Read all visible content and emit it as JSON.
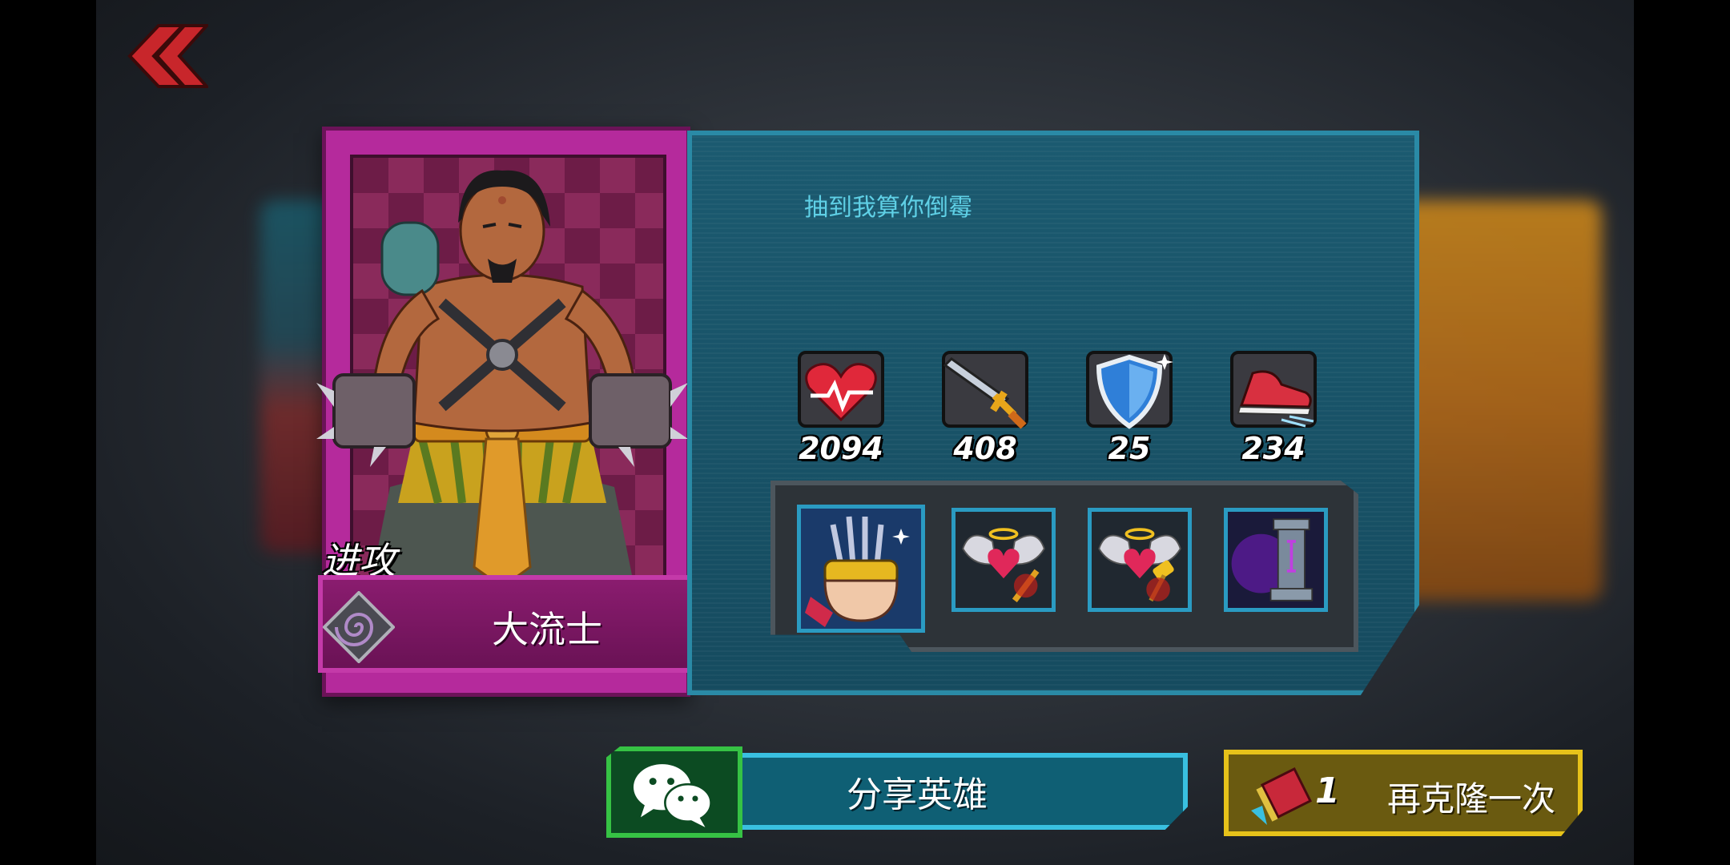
{
  "hero": {
    "role": "进攻",
    "name": "大流士",
    "quote": "抽到我算你倒霉",
    "class_icon": "spiral-icon",
    "card_color": "#b52a9c"
  },
  "stats": [
    {
      "icon": "heart-health-icon",
      "value": "2094"
    },
    {
      "icon": "sword-attack-icon",
      "value": "408"
    },
    {
      "icon": "shield-defense-icon",
      "value": "25"
    },
    {
      "icon": "shoe-speed-icon",
      "value": "234"
    }
  ],
  "skills": [
    {
      "icon": "spiked-fist-skill-icon"
    },
    {
      "icon": "winged-heart-sword-skill-icon"
    },
    {
      "icon": "winged-heart-hammer-skill-icon"
    },
    {
      "icon": "pillar-skill-icon"
    }
  ],
  "buttons": {
    "share_label": "分享英雄",
    "clone_count": "1",
    "clone_label": "再克隆一次"
  },
  "colors": {
    "panel": "#1b5a70",
    "panel_border": "#2a8aa6",
    "share_border": "#39c0e0",
    "wechat_green": "#36c244",
    "clone_gold": "#e6c21a"
  }
}
